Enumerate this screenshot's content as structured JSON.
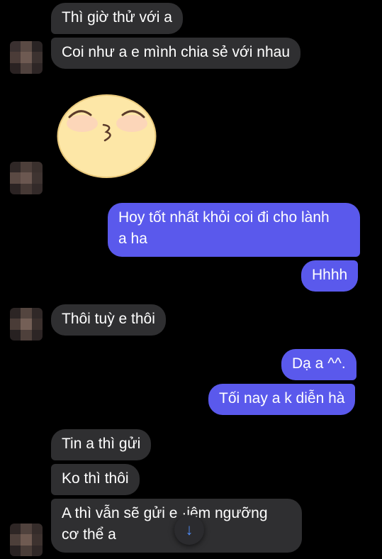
{
  "messages": {
    "m1": "Thì giờ thử với a",
    "m2": "Coi như a e mình chia sẻ với nhau",
    "m3_line1": "Hoy tốt nhất khỏi coi đi cho lành",
    "m3_line2": "a ha",
    "m4": "Hhhh",
    "m5": "Thôi tuỳ e thôi",
    "m6": "Dạ a ^^.",
    "m7": "Tối nay a k diễn hà",
    "m8": "Tin a thì gửi",
    "m9": "Ko thì thôi",
    "m10_line1": "A thì vẫn sẽ gửi e   ·iêm ngưỡng",
    "m10_line2": "cơ thể a"
  },
  "sticker": {
    "name": "kiss-face-sticker"
  },
  "scroll_button": {
    "icon": "arrow-down-icon",
    "glyph": "↓"
  },
  "colors": {
    "background": "#000000",
    "incoming_bubble": "#2f2f31",
    "outgoing_bubble": "#5a59ec",
    "accent": "#4f8df8"
  }
}
